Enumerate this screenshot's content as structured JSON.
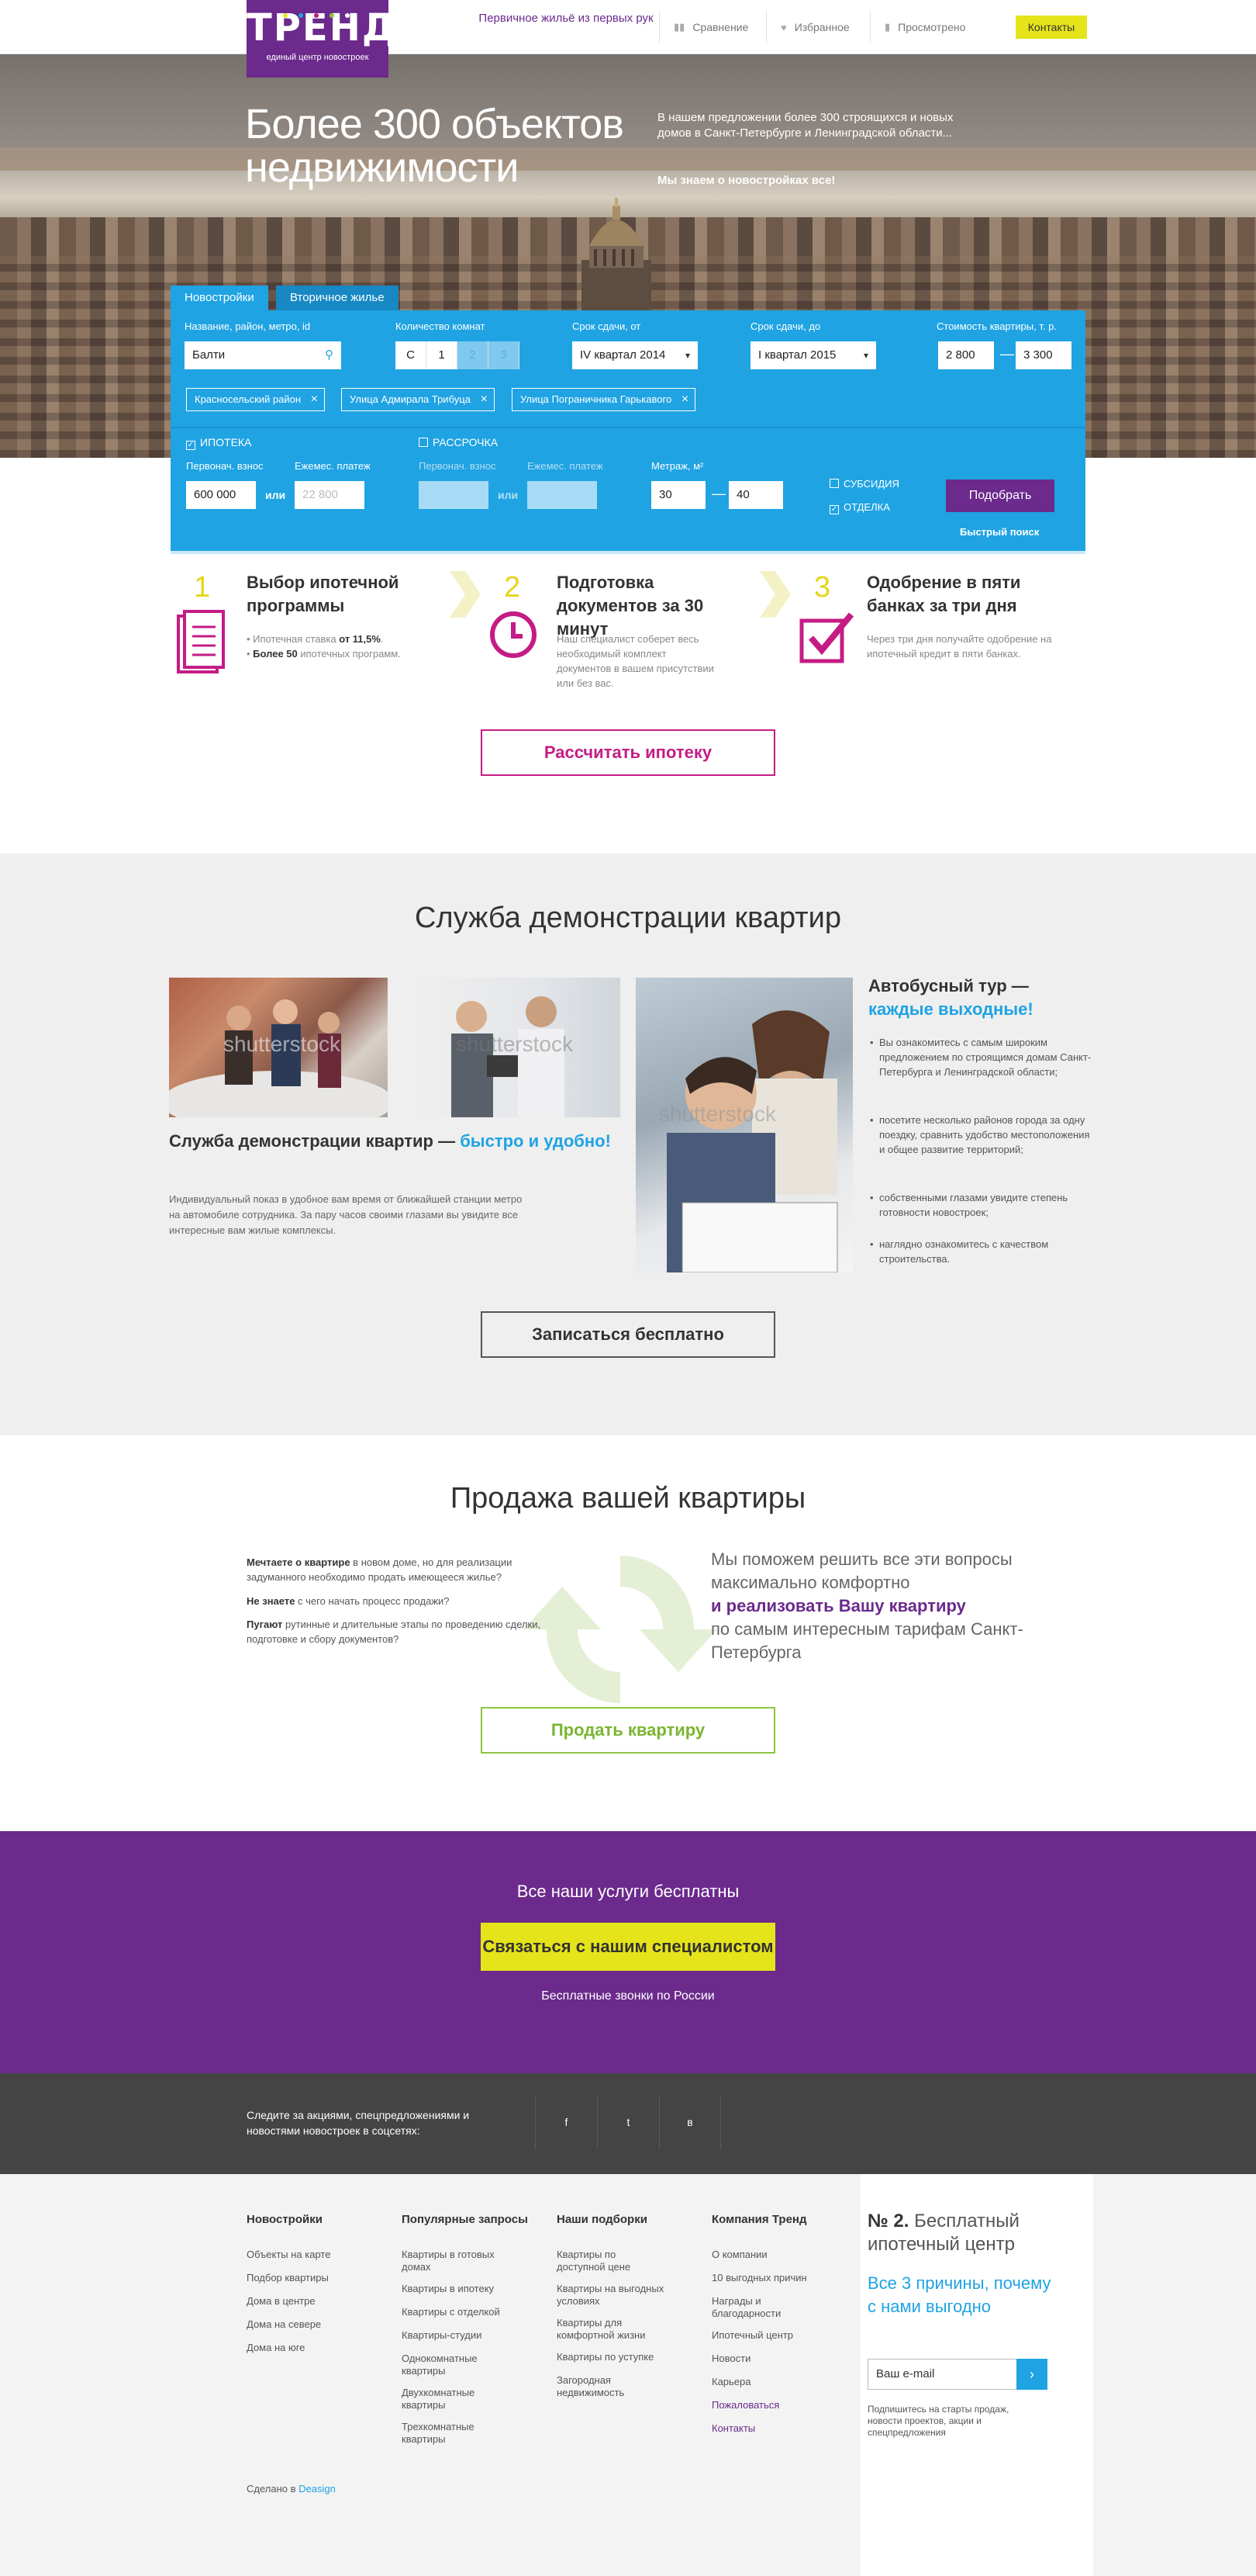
{
  "colors": {
    "purple": "#6b2a8c",
    "blue": "#1fa3e3",
    "yellow": "#e5e31a",
    "magenta": "#c41c84",
    "green": "#8cc63f",
    "dark": "#444444"
  },
  "header": {
    "logo_text": "ТРЕНД",
    "logo_sub": "единый центр новостроек",
    "tagline": "Первичное жильё из первых рук",
    "nav": [
      {
        "label": "Сравнение",
        "icon": "bar-chart-icon"
      },
      {
        "label": "Избранное",
        "icon": "heart-icon"
      },
      {
        "label": "Просмотрено",
        "icon": "bookmark-icon"
      }
    ],
    "contacts": "Контакты"
  },
  "hero": {
    "title": "Более 300 объектов недвижимости",
    "intro": "В нашем предложении более 300 строящихся и новых домов в Санкт-Петербурге и Ленинградской области...",
    "intro_bold": "Мы знаем о новостройках все!"
  },
  "search": {
    "tabs": [
      "Новостройки",
      "Вторичное жилье"
    ],
    "name_label": "Название, район, метро, id",
    "name_value": "Балти",
    "rooms_label": "Количество комнат",
    "rooms": [
      "С",
      "1",
      "2",
      "3"
    ],
    "deadline_from_label": "Срок сдачи, от",
    "deadline_from": "IV квартал 2014",
    "deadline_to_label": "Срок сдачи, до",
    "deadline_to": "I квартал 2015",
    "price_label": "Стоимость квартиры, т. р.",
    "price_from": "2 800",
    "price_to": "3 300",
    "tags": [
      "Красносельский район",
      "Улица Адмирала Трибуца",
      "Улица Пограничника Гарькавого"
    ],
    "mortgage_label": "ИПОТЕКА",
    "installment_label": "РАССРОЧКА",
    "down_label": "Первонач. взнос",
    "monthly_label": "Ежемес. платеж",
    "down_value": "600 000",
    "monthly_placeholder": "22 800",
    "or": "или",
    "area_label": "Метраж, м²",
    "area_from": "30",
    "area_to": "40",
    "subsidy": "СУБСИДИЯ",
    "finish": "ОТДЕЛКА",
    "pick": "Подобрать",
    "quick": "Быстрый поиск",
    "dash": "—"
  },
  "steps": [
    {
      "num": "1",
      "title": "Выбор ипотечной программы",
      "line1_pre": "Ипотечная ставка ",
      "line1_bold": "от 11,5%",
      "line1_post": ".",
      "line2_bold": "Более 50",
      "line2_post": " ипотечных программ."
    },
    {
      "num": "2",
      "title": "Подготовка документов за 30 минут",
      "text": "Наш специалист соберет весь необходимый комплект документов в вашем присутствии или без вас."
    },
    {
      "num": "3",
      "title": "Одобрение в пяти банках за три дня",
      "text": "Через три дня получайте одобрение на ипотечный кредит в пяти банках."
    }
  ],
  "calc_button": "Рассчитать ипотеку",
  "demo": {
    "title": "Служба демонстрации квартир",
    "sub_title": "Служба демонстрации квартир — ",
    "sub_title_accent": "быстро и удобно!",
    "text": "Индивидуальный показ в удобное вам время от ближайшей станции метро на автомобиле сотрудника. За пару часов своими глазами вы увидите все интересные вам жилые комплексы.",
    "watermark": "shutterstock",
    "bus_title": "Автобусный тур — ",
    "bus_accent": "каждые выходные!",
    "bullets": [
      "Вы ознакомитесь с самым широким предложением по строящимся домам Санкт-Петербурга и Ленинградской области;",
      "посетите несколько районов города за одну поездку, сравнить удобство местоположения и общее развитие территорий;",
      "собственными глазами увидите степень готовности новостроек;",
      "наглядно ознакомитесь с качеством строительства."
    ],
    "signup": "Записаться бесплатно"
  },
  "sale": {
    "title": "Продажа вашей квартиры",
    "p1_bold": "Мечтаете о квартире",
    "p1": " в новом доме, но для реализации задуманного необходимо продать имеющееся жилье?",
    "p2_bold": "Не знаете",
    "p2": " с чего начать процесс продажи?",
    "p3_bold": "Пугают",
    "p3": " рутинные и длительные этапы по проведению сделки, подготовке и сбору документов?",
    "right_1": "Мы поможем решить все эти вопросы максимально комфортно",
    "right_2": "и ",
    "right_accent": "реализовать Вашу квартиру",
    "right_3": "по самым интересным тарифам Санкт-Петербурга",
    "button": "Продать квартиру"
  },
  "cta": {
    "title": "Все наши услуги бесплатны",
    "button": "Связаться с нашим специалистом",
    "note": "Бесплатные звонки по России"
  },
  "social": {
    "text": "Следите за акциями, спецпредложениями и новостями новостроек в соцсетях:",
    "icons": [
      "f",
      "t",
      "в"
    ]
  },
  "footer": {
    "cols": [
      {
        "title": "Новостройки",
        "links": [
          "Объекты на карте",
          "Подбор квартиры",
          "Дома в центре",
          "Дома на севере",
          "Дома на юге"
        ]
      },
      {
        "title": "Популярные запросы",
        "links": [
          "Квартиры в готовых домах",
          "Квартиры в ипотеку",
          "Квартиры с отделкой",
          "Квартиры-студии",
          "Однокомнатные квартиры",
          "Двухкомнатные квартиры",
          "Трехкомнатные квартиры"
        ]
      },
      {
        "title": "Наши подборки",
        "links": [
          "Квартиры по доступной цене",
          "Квартиры на выгодных условиях",
          "Квартиры для комфортной жизни",
          "Квартиры по уступке",
          "Загородная недвижимость"
        ]
      },
      {
        "title": "Компания Тренд",
        "links": [
          "О компании",
          "10 выгодных причин",
          "Награды и благодарности",
          "Ипотечный центр",
          "Новости",
          "Карьера",
          "Пожаловаться",
          "Контакты"
        ]
      }
    ],
    "made_pre": "Сделано в ",
    "made_link": "Deasign",
    "n2_bold": "№ 2.",
    "n2_text": " Бесплатный ипотечный центр",
    "reasons": "Все 3 причины, почему с нами выгодно",
    "email_placeholder": "Ваш e-mail",
    "arrow": "›",
    "subscribe_note": "Подпишитесь на старты продаж, новости проектов, акции и спецпредложения"
  }
}
